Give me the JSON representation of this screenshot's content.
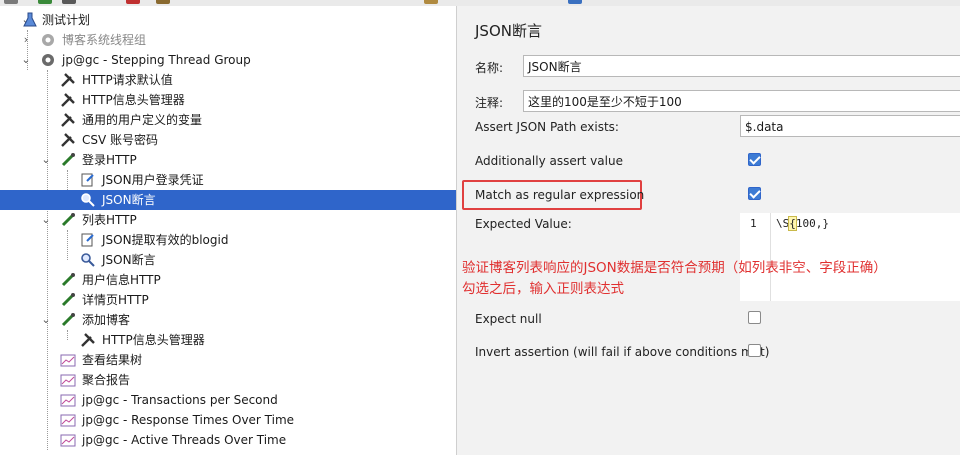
{
  "toolbar": {
    "icons": [
      "open-icon",
      "save-icon",
      "cut-icon",
      "copy-icon",
      "paste-icon",
      "run-icon",
      "settings-icon"
    ]
  },
  "tree": {
    "items": [
      {
        "label": "测试计划",
        "icon": "flask-icon",
        "expanded": true
      },
      {
        "label": "博客系统线程组",
        "icon": "gear-disabled-icon",
        "expanded": false
      },
      {
        "label": "jp@gc - Stepping Thread Group",
        "icon": "gear-icon",
        "expanded": true
      },
      {
        "label": "HTTP请求默认值",
        "icon": "wrench-icon"
      },
      {
        "label": "HTTP信息头管理器",
        "icon": "wrench-icon"
      },
      {
        "label": "通用的用户定义的变量",
        "icon": "wrench-icon"
      },
      {
        "label": "CSV 账号密码",
        "icon": "wrench-icon"
      },
      {
        "label": "登录HTTP",
        "icon": "pipette-icon",
        "expanded": true
      },
      {
        "label": "JSON用户登录凭证",
        "icon": "extractor-icon"
      },
      {
        "label": "JSON断言",
        "icon": "magnifier-icon",
        "selected": true
      },
      {
        "label": "列表HTTP",
        "icon": "pipette-icon",
        "expanded": true
      },
      {
        "label": "JSON提取有效的blogid",
        "icon": "extractor-icon"
      },
      {
        "label": "JSON断言",
        "icon": "magnifier-icon"
      },
      {
        "label": "用户信息HTTP",
        "icon": "pipette-icon"
      },
      {
        "label": "详情页HTTP",
        "icon": "pipette-icon"
      },
      {
        "label": "添加博客",
        "icon": "pipette-icon",
        "expanded": true
      },
      {
        "label": "HTTP信息头管理器",
        "icon": "wrench-icon"
      },
      {
        "label": "查看结果树",
        "icon": "graph-icon"
      },
      {
        "label": "聚合报告",
        "icon": "graph-icon"
      },
      {
        "label": "jp@gc - Transactions per Second",
        "icon": "graph-icon"
      },
      {
        "label": "jp@gc - Response Times Over Time",
        "icon": "graph-icon"
      },
      {
        "label": "jp@gc - Active Threads Over Time",
        "icon": "graph-icon"
      }
    ]
  },
  "panel": {
    "title": "JSON断言",
    "name_label": "名称:",
    "name_value": "JSON断言",
    "comment_label": "注释:",
    "comment_value": "这里的100是至少不短于100",
    "path_label": "Assert JSON Path exists:",
    "path_value": "$.data",
    "additionally_label": "Additionally assert value",
    "additionally_checked": true,
    "regex_label": "Match as regular expression",
    "regex_checked": true,
    "expected_label": "Expected Value:",
    "expected_line_number": "1",
    "expected_code_before": "\\S",
    "expected_code_cursor": "{",
    "expected_code_after": "100,}",
    "annotation_line1": "验证博客列表响应的JSON数据是否符合预期（如列表非空、字段正确）",
    "annotation_line2": "勾选之后，输入正则表达式",
    "expect_null_label": "Expect null",
    "expect_null_checked": false,
    "invert_label": "Invert assertion (will fail if above conditions met)",
    "invert_checked": false
  },
  "colors": {
    "selection": "#2f65ca",
    "annotation": "#e03030",
    "checkbox": "#3d7bd4"
  }
}
